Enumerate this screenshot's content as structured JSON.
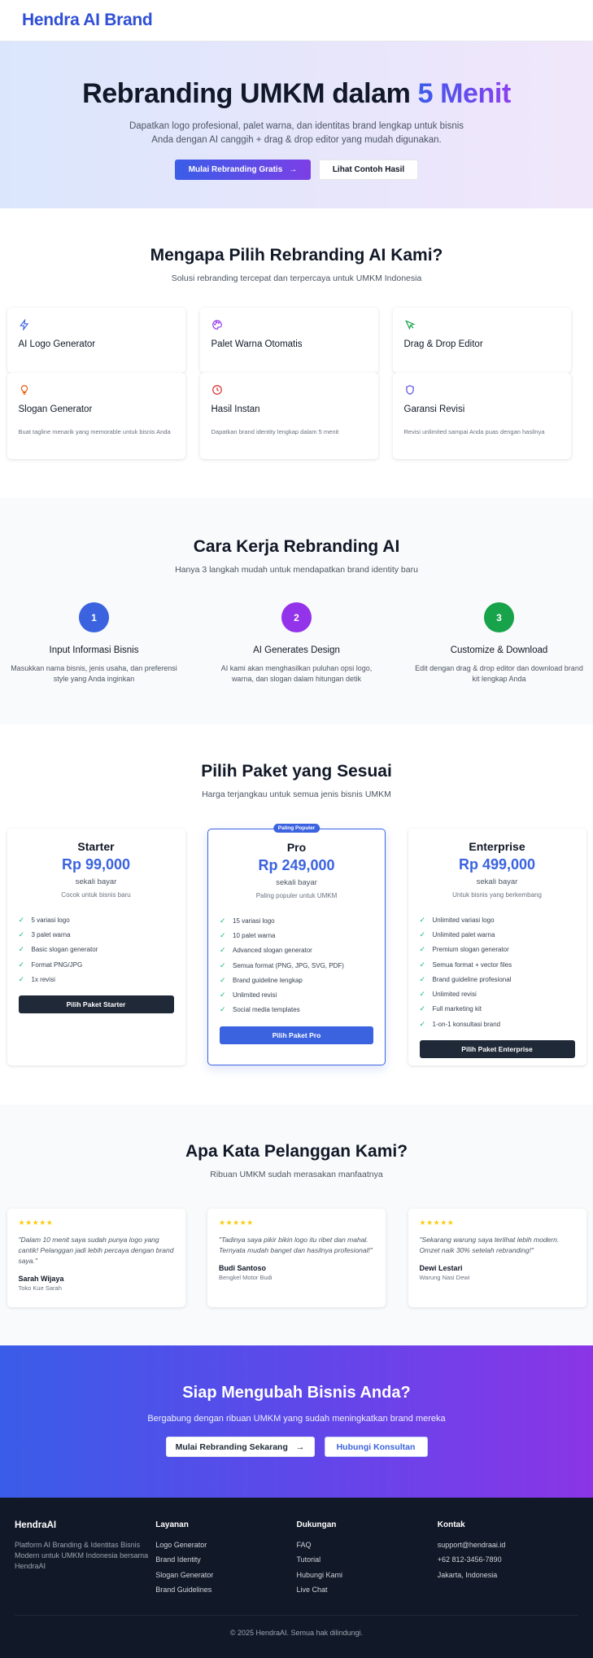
{
  "header": {
    "brand": "Hendra AI Brand"
  },
  "hero": {
    "title_main": "Rebranding UMKM dalam ",
    "title_accent": "5 Menit",
    "subtitle": "Dapatkan logo profesional, palet warna, dan identitas brand lengkap untuk bisnis Anda dengan AI canggih + drag & drop editor yang mudah digunakan.",
    "primary_button": "Mulai Rebranding Gratis",
    "secondary_button": "Lihat Contoh Hasil"
  },
  "features": {
    "title": "Mengapa Pilih Rebranding AI Kami?",
    "subtitle": "Solusi rebranding tercepat dan terpercaya untuk UMKM Indonesia",
    "items": [
      {
        "icon": "lightning-icon",
        "title": "AI Logo Generator",
        "desc": "",
        "color": "#3b63e0"
      },
      {
        "icon": "palette-icon",
        "title": "Palet Warna Otomatis",
        "desc": "",
        "color": "#9333ea"
      },
      {
        "icon": "cursor-icon",
        "title": "Drag & Drop Editor",
        "desc": "",
        "color": "#16a34a"
      },
      {
        "icon": "bulb-icon",
        "title": "Slogan Generator",
        "desc": "Buat tagline menarik yang memorable untuk bisnis Anda",
        "color": "#ea580c"
      },
      {
        "icon": "clock-icon",
        "title": "Hasil Instan",
        "desc": "Dapatkan brand identity lengkap dalam 5 menit",
        "color": "#dc2626"
      },
      {
        "icon": "shield-icon",
        "title": "Garansi Revisi",
        "desc": "Revisi unlimited sampai Anda puas dengan hasilnya",
        "color": "#4f46e5"
      }
    ]
  },
  "how": {
    "title": "Cara Kerja Rebranding AI",
    "subtitle": "Hanya 3 langkah mudah untuk mendapatkan brand identity baru",
    "steps": [
      {
        "num": "1",
        "title": "Input Informasi Bisnis",
        "desc": "Masukkan nama bisnis, jenis usaha, dan preferensi style yang Anda inginkan",
        "color": "#3b63e0"
      },
      {
        "num": "2",
        "title": "AI Generates Design",
        "desc": "AI kami akan menghasilkan puluhan opsi logo, warna, dan slogan dalam hitungan detik",
        "color": "#9333ea"
      },
      {
        "num": "3",
        "title": "Customize & Download",
        "desc": "Edit dengan drag & drop editor dan download brand kit lengkap Anda",
        "color": "#16a34a"
      }
    ]
  },
  "pricing": {
    "title": "Pilih Paket yang Sesuai",
    "subtitle": "Harga terjangkau untuk semua jenis bisnis UMKM",
    "plans": [
      {
        "name": "Starter",
        "price": "Rp 99,000",
        "period": "sekali bayar",
        "desc": "Cocok untuk bisnis baru",
        "badge": "",
        "features": [
          "5 variasi logo",
          "3 palet warna",
          "Basic slogan generator",
          "Format PNG/JPG",
          "1x revisi"
        ],
        "button": "Pilih Paket Starter"
      },
      {
        "name": "Pro",
        "price": "Rp 249,000",
        "period": "sekali bayar",
        "desc": "Paling populer untuk UMKM",
        "badge": "Paling Populer",
        "features": [
          "15 variasi logo",
          "10 palet warna",
          "Advanced slogan generator",
          "Semua format (PNG, JPG, SVG, PDF)",
          "Brand guideline lengkap",
          "Unlimited revisi",
          "Social media templates"
        ],
        "button": "Pilih Paket Pro"
      },
      {
        "name": "Enterprise",
        "price": "Rp 499,000",
        "period": "sekali bayar",
        "desc": "Untuk bisnis yang berkembang",
        "badge": "",
        "features": [
          "Unlimited variasi logo",
          "Unlimited palet warna",
          "Premium slogan generator",
          "Semua format + vector files",
          "Brand guideline profesional",
          "Unlimited revisi",
          "Full marketing kit",
          "1-on-1 konsultasi brand"
        ],
        "button": "Pilih Paket Enterprise"
      }
    ]
  },
  "testimonials": {
    "title": "Apa Kata Pelanggan Kami?",
    "subtitle": "Ribuan UMKM sudah merasakan manfaatnya",
    "items": [
      {
        "stars": "★★★★★",
        "quote": "\"Dalam 10 menit saya sudah punya logo yang cantik! Pelanggan jadi lebih percaya dengan brand saya.\"",
        "name": "Sarah Wijaya",
        "role": "Toko Kue Sarah"
      },
      {
        "stars": "★★★★★",
        "quote": "\"Tadinya saya pikir bikin logo itu ribet dan mahal. Ternyata mudah banget dan hasilnya profesional!\"",
        "name": "Budi Santoso",
        "role": "Bengkel Motor Budi"
      },
      {
        "stars": "★★★★★",
        "quote": "\"Sekarang warung saya terlihat lebih modern. Omzet naik 30% setelah rebranding!\"",
        "name": "Dewi Lestari",
        "role": "Warung Nasi Dewi"
      }
    ]
  },
  "cta": {
    "title": "Siap Mengubah Bisnis Anda?",
    "subtitle": "Bergabung dengan ribuan UMKM yang sudah meningkatkan brand mereka",
    "primary_button": "Mulai Rebranding Sekarang",
    "secondary_button": "Hubungi Konsultan"
  },
  "footer": {
    "brand": "HendraAI",
    "tagline": "Platform AI Branding & Identitas Bisnis Modern untuk UMKM Indonesia bersama HendraAI",
    "columns": [
      {
        "heading": "Layanan",
        "links": [
          "Logo Generator",
          "Brand Identity",
          "Slogan Generator",
          "Brand Guidelines"
        ]
      },
      {
        "heading": "Dukungan",
        "links": [
          "FAQ",
          "Tutorial",
          "Hubungi Kami",
          "Live Chat"
        ]
      },
      {
        "heading": "Kontak",
        "links": [
          "support@hendraai.id",
          "+62 812-3456-7890",
          "Jakarta, Indonesia"
        ]
      }
    ],
    "copyright": "© 2025 HendraAI. Semua hak dilindungi."
  }
}
